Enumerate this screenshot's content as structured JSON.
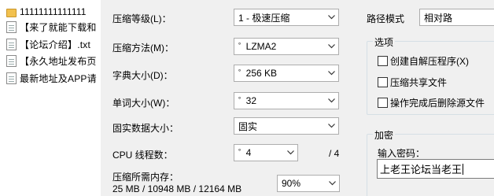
{
  "files": [
    {
      "name": "11111111111111",
      "kind": "folder",
      "icon": "folder-icon"
    },
    {
      "name": "【来了就能下载和",
      "kind": "doc",
      "icon": "document-icon"
    },
    {
      "name": "【论坛介绍】.txt",
      "kind": "doc",
      "icon": "document-icon"
    },
    {
      "name": "【永久地址发布页",
      "kind": "doc",
      "icon": "document-icon"
    },
    {
      "name": "最新地址及APP请",
      "kind": "doc",
      "icon": "document-icon"
    }
  ],
  "settings": {
    "level_label": "压缩等级(L)：",
    "level_value": "1 - 极速压缩",
    "method_label": "压缩方法(M)：",
    "method_value": "LZMA2",
    "dict_label": "字典大小(D)：",
    "dict_value": "256 KB",
    "word_label": "单词大小(W)：",
    "word_value": "32",
    "solid_label": "固实数据大小：",
    "solid_value": "固实",
    "cpu_label": "CPU 线程数：",
    "cpu_value": "4",
    "cpu_total": "/ 4",
    "mem_label": "压缩所需内存：",
    "mem_values": "25 MB / 10948 MB / 12164 MB",
    "mem_percent": "90%"
  },
  "path_mode": {
    "label": "路径模式",
    "value": "相对路"
  },
  "options": {
    "title": "选项",
    "items": [
      {
        "label": "创建自解压程序(X)",
        "checked": false
      },
      {
        "label": "压缩共享文件",
        "checked": false
      },
      {
        "label": "操作完成后删除源文件",
        "checked": false
      }
    ]
  },
  "encryption": {
    "title": "加密",
    "password_label": "输入密码：",
    "password_value": "上老王论坛当老王"
  }
}
